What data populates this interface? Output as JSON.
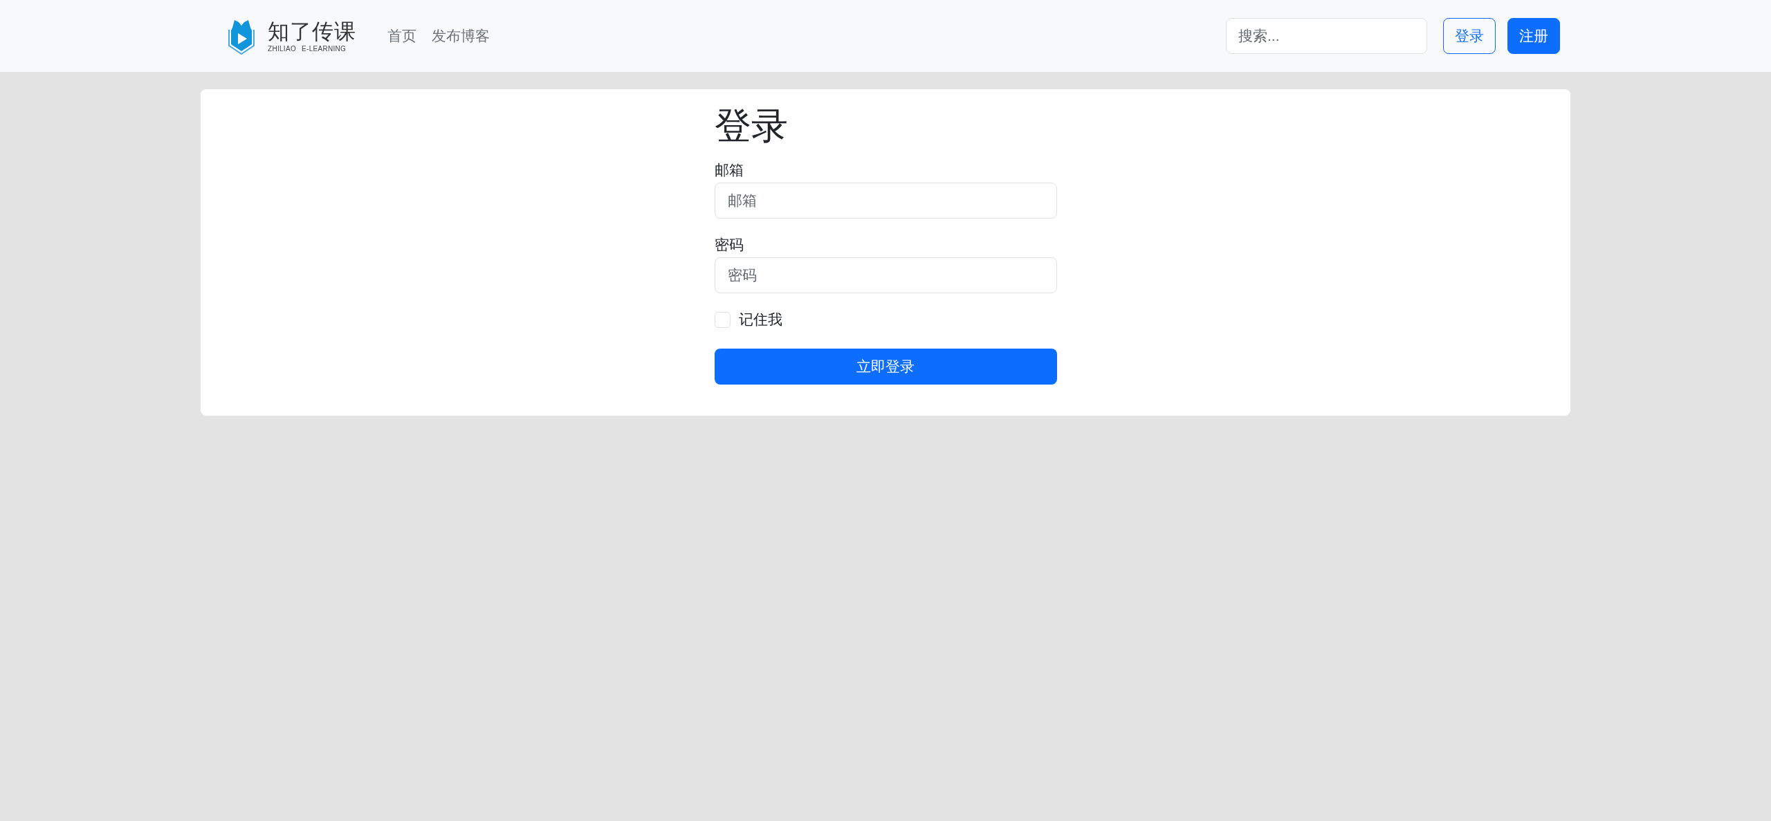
{
  "navbar": {
    "brand": {
      "name": "知了传课",
      "tagline": "ZHILIAO E-LEARNING"
    },
    "links": [
      {
        "label": "首页"
      },
      {
        "label": "发布博客"
      }
    ],
    "search": {
      "placeholder": "搜索..."
    },
    "buttons": [
      {
        "label": "登录",
        "kind": "outline"
      },
      {
        "label": "注册",
        "kind": "solid"
      }
    ]
  },
  "login_form": {
    "title": "登录",
    "fields": [
      {
        "label": "邮箱",
        "placeholder": "邮箱"
      },
      {
        "label": "密码",
        "placeholder": "密码"
      }
    ],
    "remember": {
      "label": "记住我",
      "checked": false
    },
    "submit": "立即登录"
  }
}
